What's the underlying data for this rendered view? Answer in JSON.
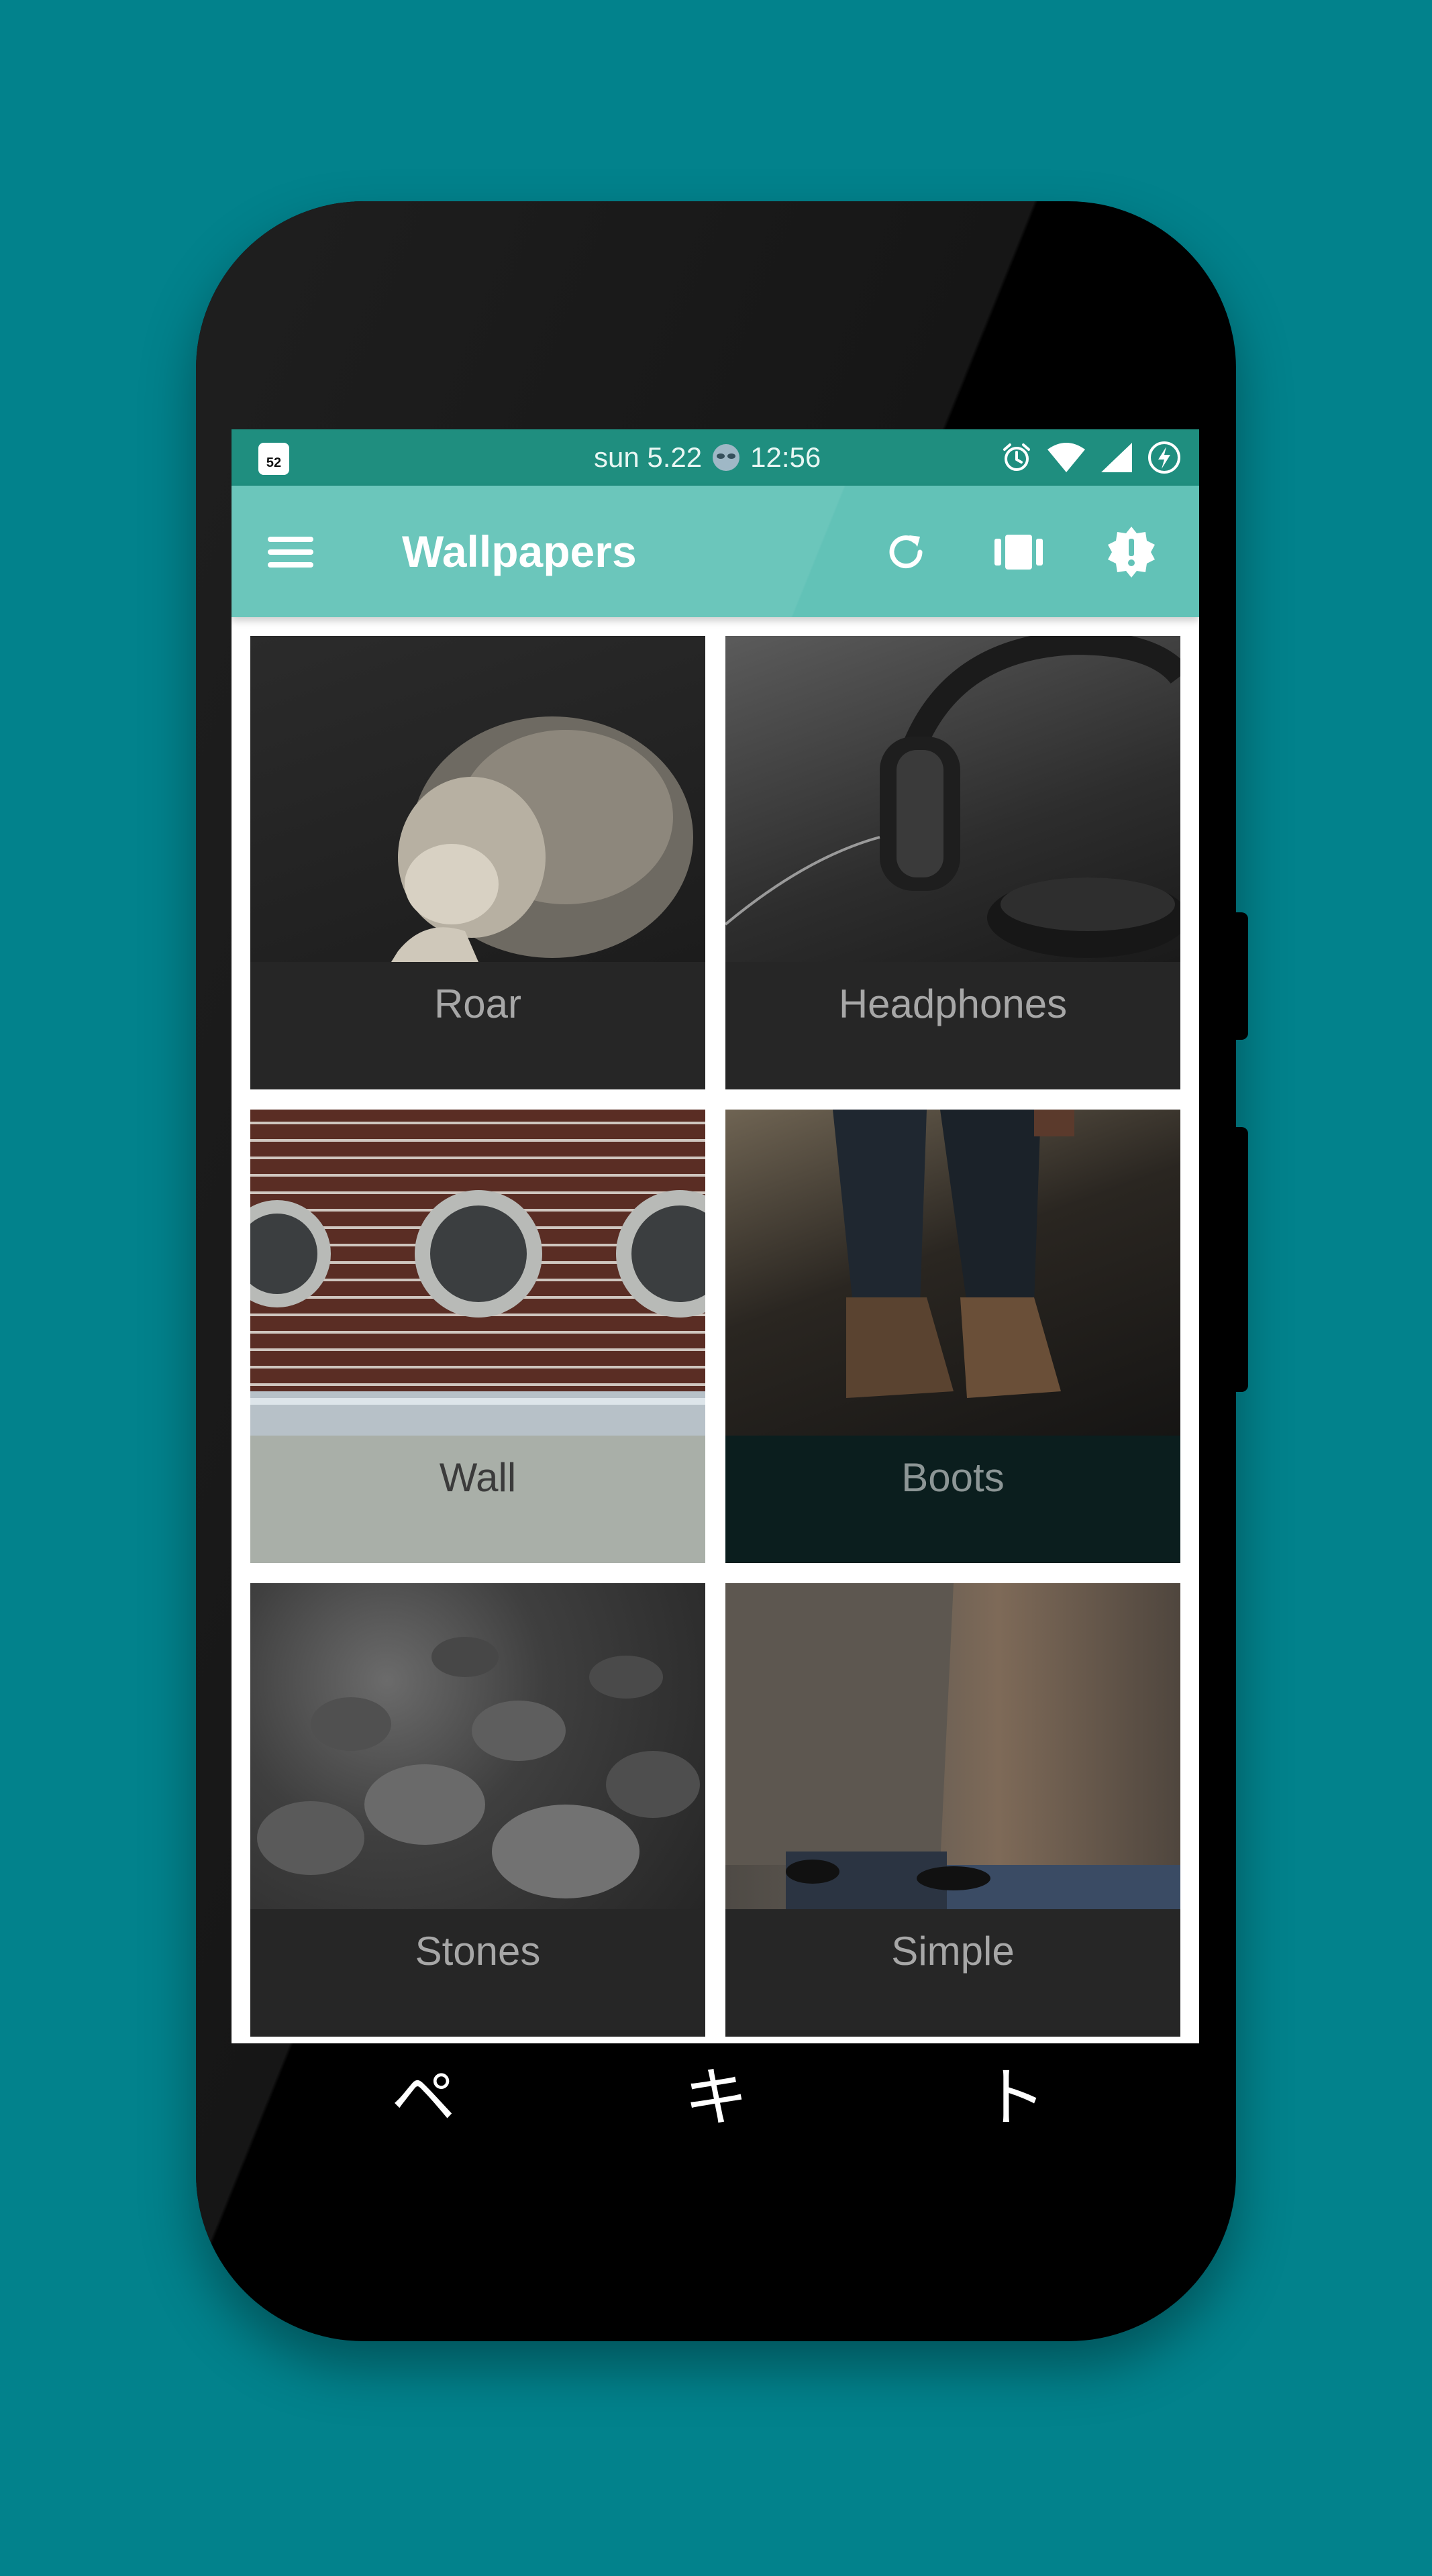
{
  "status_bar": {
    "calendar_day": "52",
    "center_text": "sun 5.22",
    "time": "12:56",
    "icons": [
      "calendar-icon",
      "alien-icon",
      "alarm-icon",
      "wifi-icon",
      "signal-icon",
      "battery-charging-icon"
    ]
  },
  "app_bar": {
    "title": "Wallpapers",
    "actions": [
      "refresh-icon",
      "view-columns-icon",
      "alert-badge-icon"
    ]
  },
  "wallpapers": [
    {
      "label": "Roar"
    },
    {
      "label": "Headphones"
    },
    {
      "label": "Wall"
    },
    {
      "label": "Boots"
    },
    {
      "label": "Stones"
    },
    {
      "label": "Simple"
    }
  ],
  "nav_bar": {
    "back_glyph": "ペ",
    "home_glyph": "キ",
    "recents_glyph": "ト"
  },
  "colors": {
    "background": "#02828c",
    "status_bar": "#1f8e7f",
    "app_bar": "#62c2b7",
    "card_caption": "#262626",
    "wall_caption": "#a9afa8",
    "boots_caption": "#0b1e1e"
  }
}
